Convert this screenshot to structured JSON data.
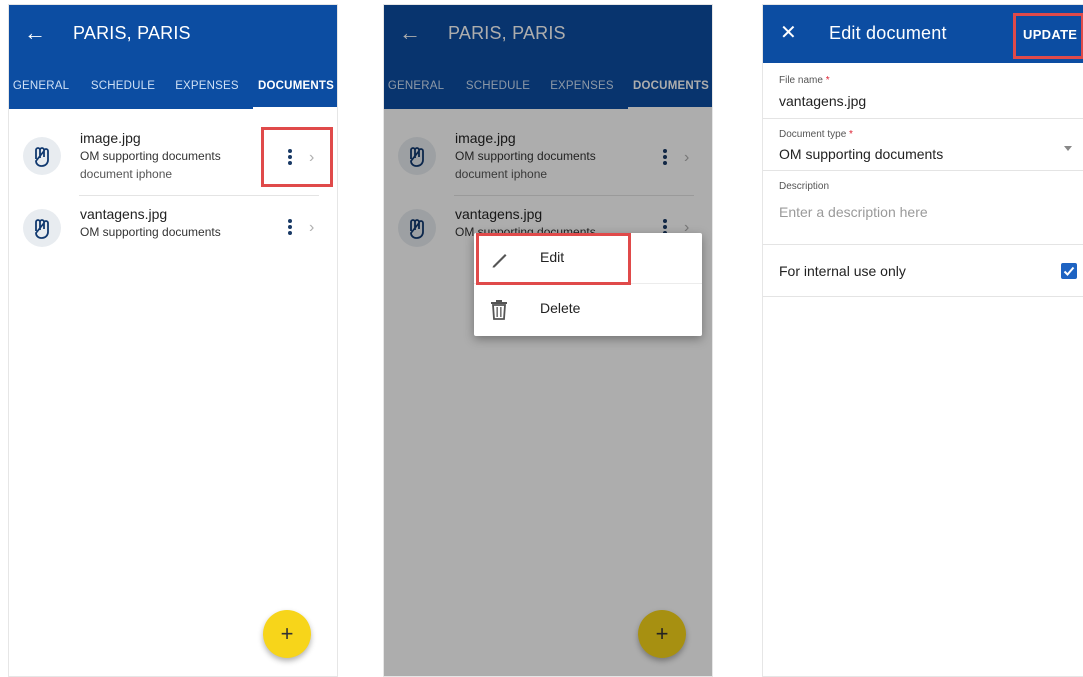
{
  "colors": {
    "primary": "#0c4da2",
    "fab": "#f7d51a",
    "highlight": "#e04a4a",
    "checkbox": "#1e63c2"
  },
  "trip": {
    "back_icon": "arrow-left-icon",
    "title": "PARIS, PARIS",
    "tabs": [
      {
        "label": "GENERAL"
      },
      {
        "label": "SCHEDULE"
      },
      {
        "label": "EXPENSES"
      },
      {
        "label": "DOCUMENTS"
      }
    ],
    "documents": [
      {
        "icon": "paperclip-icon",
        "name": "image.jpg",
        "type": "OM supporting documents",
        "description": "document iphone"
      },
      {
        "icon": "paperclip-icon",
        "name": "vantagens.jpg",
        "type": "OM supporting documents"
      }
    ],
    "fab_label": "+"
  },
  "context_menu": {
    "items": [
      {
        "icon": "pencil-icon",
        "label": "Edit"
      },
      {
        "icon": "trash-icon",
        "label": "Delete"
      }
    ]
  },
  "edit_document": {
    "close_icon": "close-icon",
    "title": "Edit document",
    "update_label": "UPDATE",
    "file_name": {
      "label": "File name",
      "required_mark": "*",
      "value": "vantagens.jpg"
    },
    "document_type": {
      "label": "Document type",
      "required_mark": "*",
      "value": "OM supporting documents"
    },
    "description": {
      "label": "Description",
      "placeholder": "Enter a description here"
    },
    "internal_only": {
      "label": "For internal use only",
      "checked": true
    }
  }
}
